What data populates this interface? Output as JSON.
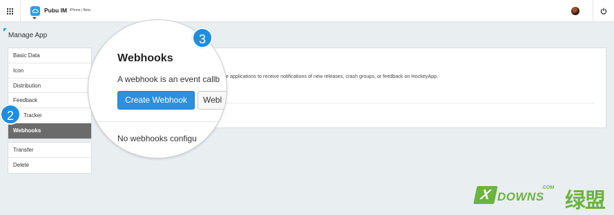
{
  "header": {
    "app_name": "Pubu IM",
    "platform": "iPhone | Beta"
  },
  "page_title": "Manage App",
  "sidebar": {
    "items": [
      {
        "label": "Basic Data"
      },
      {
        "label": "Icon"
      },
      {
        "label": "Distribution"
      },
      {
        "label": "Feedback"
      },
      {
        "label": "Tracker"
      },
      {
        "label": "Webhooks",
        "active": true
      }
    ],
    "secondary_items": [
      {
        "label": "Transfer"
      },
      {
        "label": "Delete"
      }
    ]
  },
  "content": {
    "title": "Webhooks",
    "description_start": "A webhook is an event callb",
    "description_end": "ote applications to receive notifications of new releases, crash groups, or feedback on HockeyApp.",
    "create_button": "Create Webhook",
    "second_button": "Webl",
    "empty_state": "No webhooks configu"
  },
  "badges": {
    "step_2": "2",
    "step_3": "3"
  },
  "watermark": {
    "x_mark": "X",
    "brand": "DOWNS",
    "com": ".COM",
    "chinese": "绿盟"
  },
  "colors": {
    "accent": "#2c8fe0",
    "active_nav": "#6b6b6b",
    "watermark_green": "#6cb33f"
  },
  "icons": [
    "grid-icon",
    "app-cloud-icon",
    "chevron-down-icon",
    "user-avatar",
    "power-icon"
  ]
}
